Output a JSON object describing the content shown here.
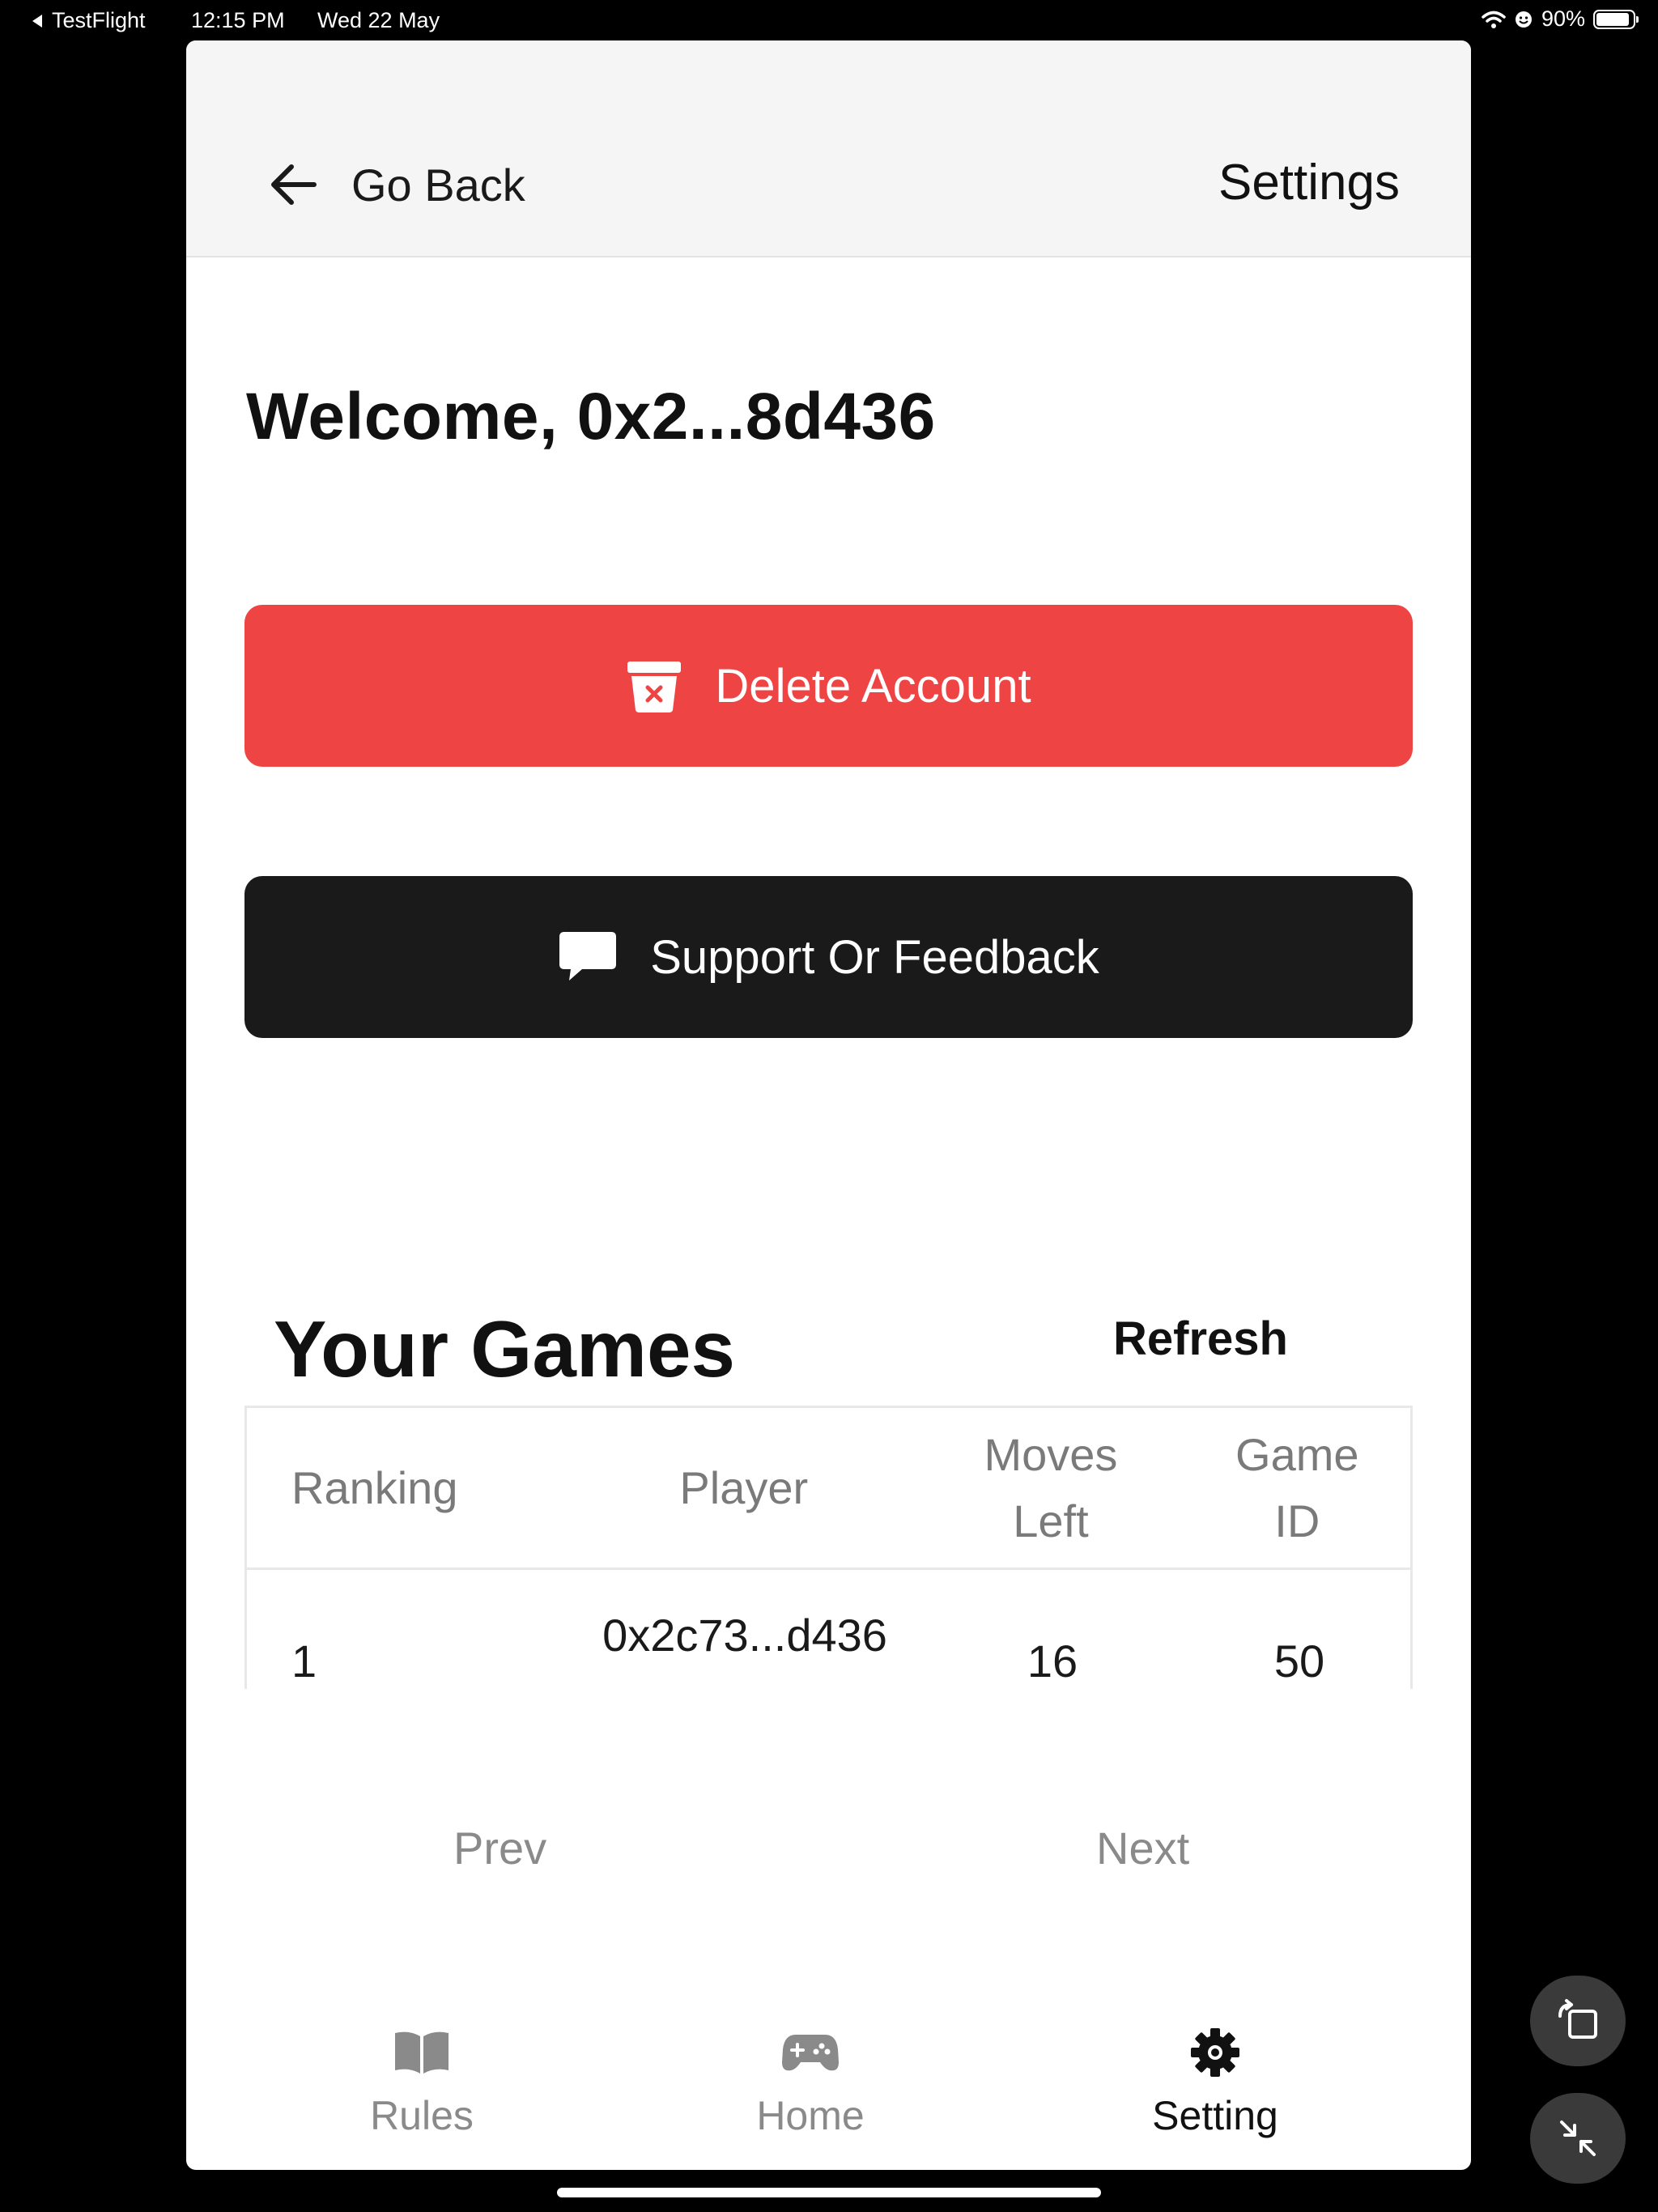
{
  "status_bar": {
    "back_app": "TestFlight",
    "time": "12:15 PM",
    "date": "Wed 22 May",
    "battery": "90%",
    "battery_level": 0.9
  },
  "header": {
    "back_label": "Go Back",
    "title": "Settings"
  },
  "welcome": "Welcome, 0x2...8d436",
  "buttons": {
    "delete_account": "Delete Account",
    "support": "Support Or Feedback"
  },
  "games": {
    "title": "Your Games",
    "refresh": "Refresh",
    "columns": {
      "ranking": "Ranking",
      "player": "Player",
      "moves_left_line1": "Moves",
      "moves_left_line2": "Left",
      "game_id_line1": "Game",
      "game_id_line2": "ID"
    },
    "rows": [
      {
        "ranking": "1",
        "player": "0x2c73...d436",
        "moves_left": "16",
        "game_id": "50"
      }
    ],
    "prev": "Prev",
    "next": "Next"
  },
  "tabs": [
    {
      "label": "Rules",
      "icon": "book-icon"
    },
    {
      "label": "Home",
      "icon": "gamepad-icon"
    },
    {
      "label": "Setting",
      "icon": "gear-icon",
      "active": true
    }
  ],
  "colors": {
    "delete_button": "#ef4444",
    "support_button": "#1a1a1a",
    "active_tab": "#111111",
    "inactive_tab": "#8a8a8a"
  }
}
